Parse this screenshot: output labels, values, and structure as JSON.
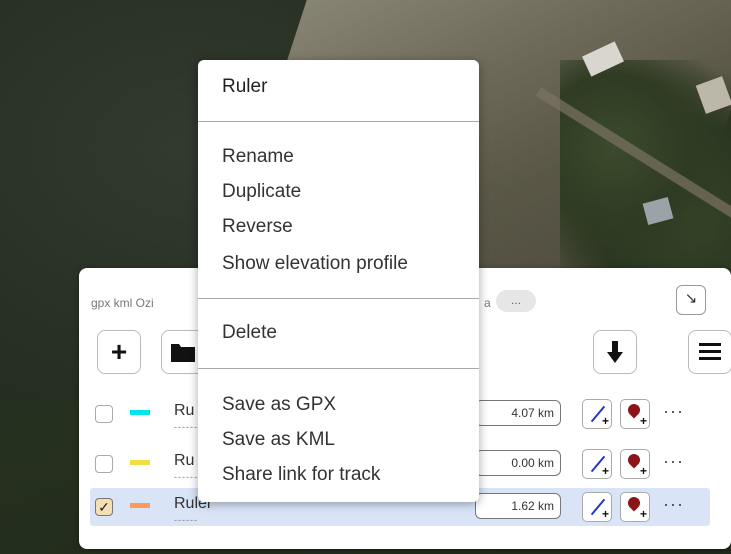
{
  "panel": {
    "format_text": "gpx kml Ozi",
    "format_tail": "a",
    "more_pill": "...",
    "collapse_icon": "↘",
    "add_label": "+",
    "menu_icon": "≡",
    "download_icon": "🡇",
    "tracks": [
      {
        "name": "Ru",
        "color": "#00e5ee",
        "distance": "4.07 km",
        "checked": false,
        "dashes": "------"
      },
      {
        "name": "Ru",
        "color": "#f0e040",
        "distance": "0.00 km",
        "checked": false,
        "dashes": "------"
      },
      {
        "name": "Ruler",
        "color": "#ff9a5a",
        "distance": "1.62 km",
        "checked": true,
        "dashes": "------"
      }
    ],
    "row_more": "···",
    "check_mark": "✓"
  },
  "context_menu": {
    "title": "Ruler",
    "items": [
      "Rename",
      "Duplicate",
      "Reverse",
      "Show elevation profile",
      "Delete",
      "Save as GPX",
      "Save as KML",
      "Share link for track"
    ]
  }
}
